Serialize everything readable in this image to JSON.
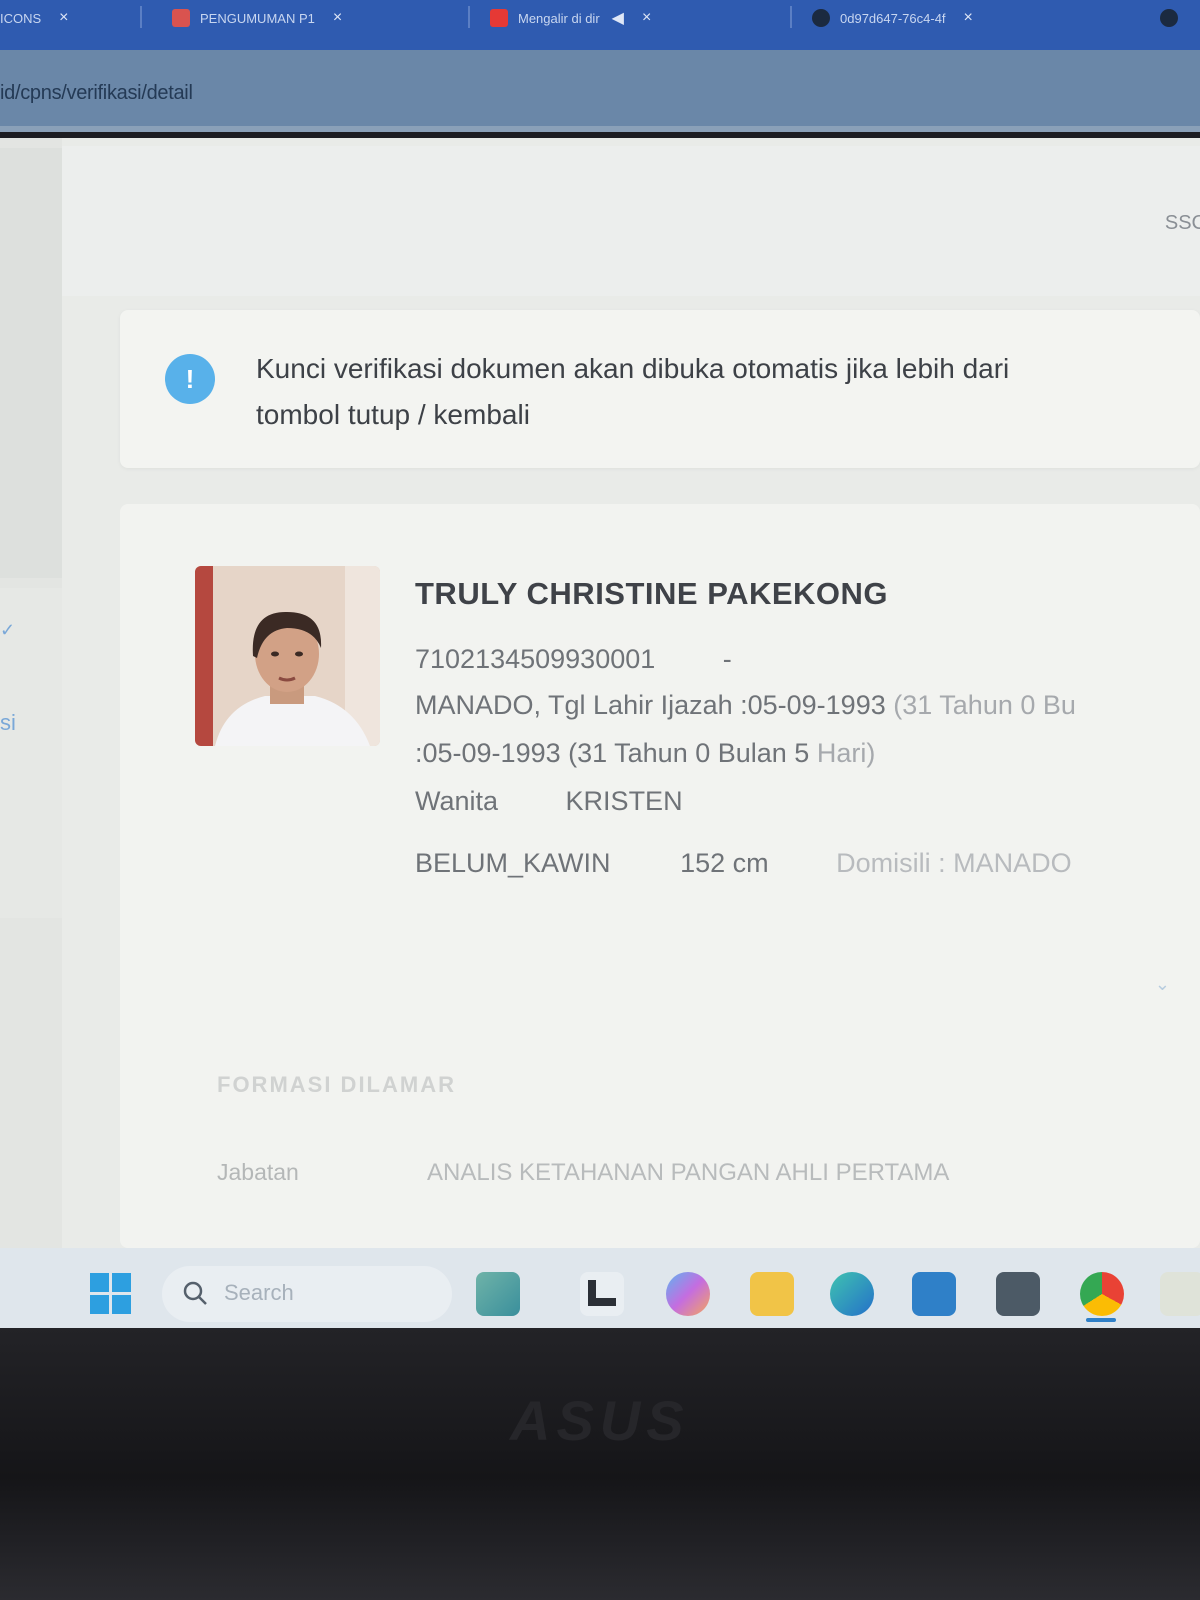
{
  "browser": {
    "tabs": [
      {
        "title": "ICONS",
        "close": "×"
      },
      {
        "title": "PENGUMUMAN P1",
        "close": "×"
      },
      {
        "title": "Mengalir di dir",
        "close": "×"
      },
      {
        "title": "0d97d647-76c4-4f",
        "close": "×"
      }
    ],
    "url": "id/cpns/verifikasi/detail"
  },
  "header": {
    "user_text": "SSC"
  },
  "sidebar": {
    "chevron": "✓",
    "label": "si"
  },
  "alert": {
    "icon": "!",
    "icon_name": "info-icon",
    "line1": "Kunci verifikasi dokumen akan dibuka otomatis jika lebih dari",
    "line2": "tombol tutup / kembali"
  },
  "profile": {
    "name": "TRULY CHRISTINE PAKEKONG",
    "nik": "7102134509930001",
    "nik_suffix": "-",
    "birth_line": "MANADO, Tgl Lahir Ijazah :05-09-1993",
    "birth_line_age": "(31 Tahun 0 Bu",
    "birth_line2": ":05-09-1993 (31 Tahun 0 Bulan 5",
    "birth_line2_end": "Hari)",
    "gender": "Wanita",
    "religion": "KRISTEN",
    "marital_status": "BELUM_KAWIN",
    "height": "152 cm",
    "domicile": "Domisili : MANADO"
  },
  "formasi": {
    "section_title": "FORMASI DILAMAR",
    "position_label": "Jabatan",
    "position_value": "ANALIS KETAHANAN PANGAN AHLI PERTAMA"
  },
  "taskbar": {
    "search_placeholder": "Search"
  },
  "device": {
    "logo": "ASUS"
  },
  "colors": {
    "accent": "#58b1ea",
    "tabstrip": "#2f5bb0",
    "taskbar": "#dfe6ec"
  }
}
